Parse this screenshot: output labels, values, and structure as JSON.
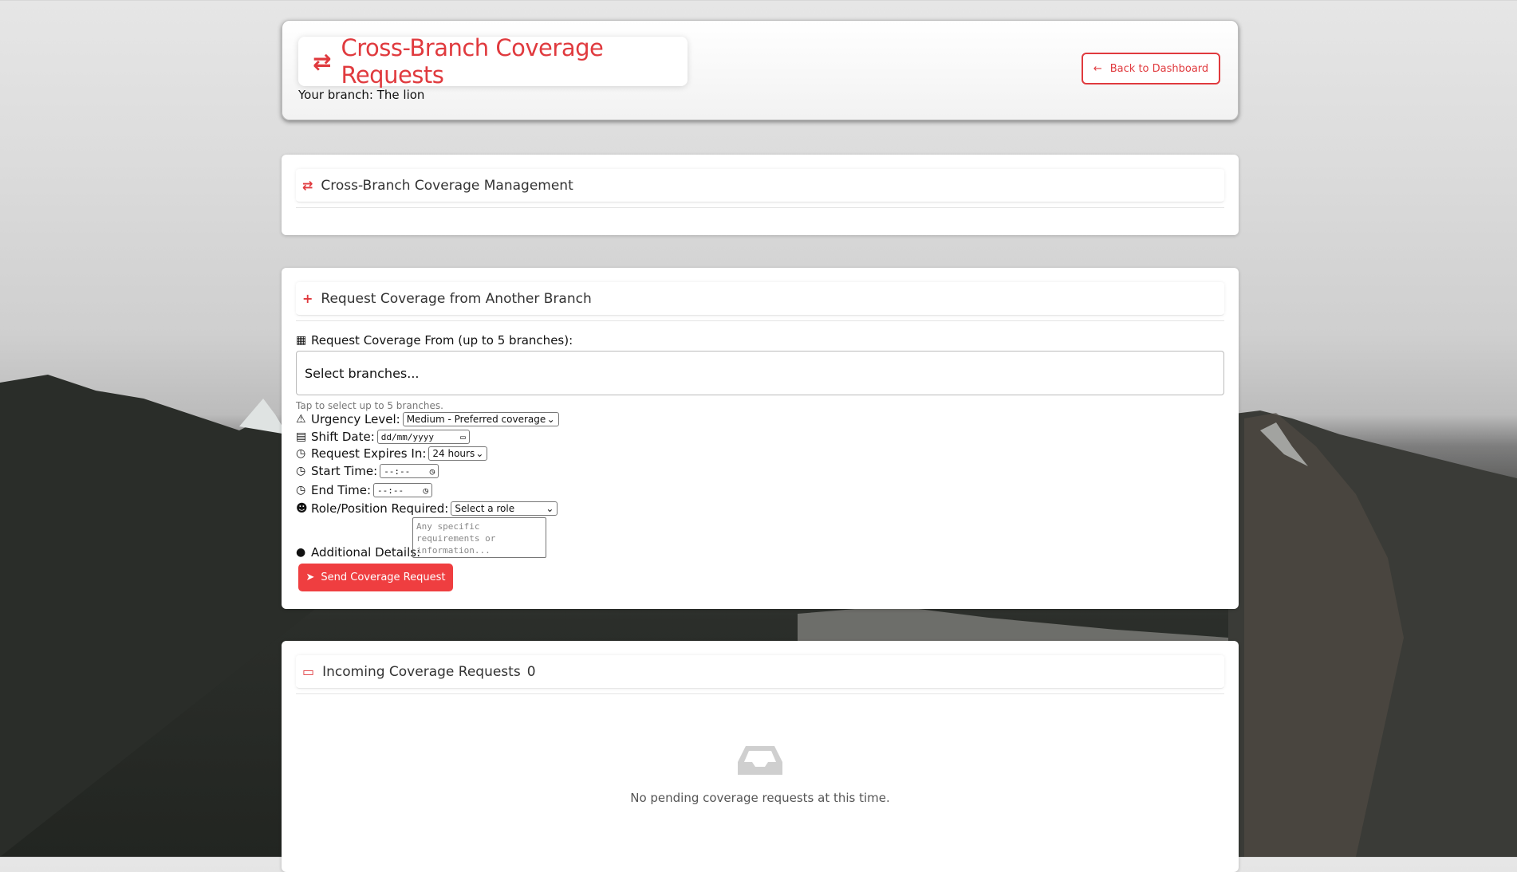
{
  "header": {
    "title": "Cross-Branch Coverage Requests",
    "title_icon": "exchange-icon",
    "branch_info": "Your branch: The lion",
    "back_button_label": "Back to Dashboard",
    "back_icon": "arrow-left-icon"
  },
  "management": {
    "title": "Cross-Branch Coverage Management",
    "icon": "exchange-icon"
  },
  "request_form": {
    "title": "Request Coverage from Another Branch",
    "icon": "plus-icon",
    "branches_label": "Request Coverage From (up to 5 branches):",
    "branches_placeholder": "Select branches...",
    "branches_hint": "Tap to select up to 5 branches.",
    "urgency_label": "Urgency Level:",
    "urgency_value": "Medium - Preferred coverage",
    "shift_date_label": "Shift Date:",
    "shift_date_value": "dd/mm/yyyy",
    "expires_label": "Request Expires In:",
    "expires_value": "24 hours",
    "start_time_label": "Start Time:",
    "start_time_value": "--:--",
    "end_time_label": "End Time:",
    "end_time_value": "--:--",
    "role_label": "Role/Position Required:",
    "role_value": "Select a role",
    "details_label": "Additional Details:",
    "details_placeholder": "Any specific requirements or information...",
    "send_button_label": "Send Coverage Request"
  },
  "incoming": {
    "title": "Incoming Coverage Requests",
    "count": "0",
    "icon": "inbox-icon",
    "empty_text": "No pending coverage requests at this time."
  },
  "colors": {
    "accent": "#e03a3e",
    "button": "#ef3e40"
  }
}
